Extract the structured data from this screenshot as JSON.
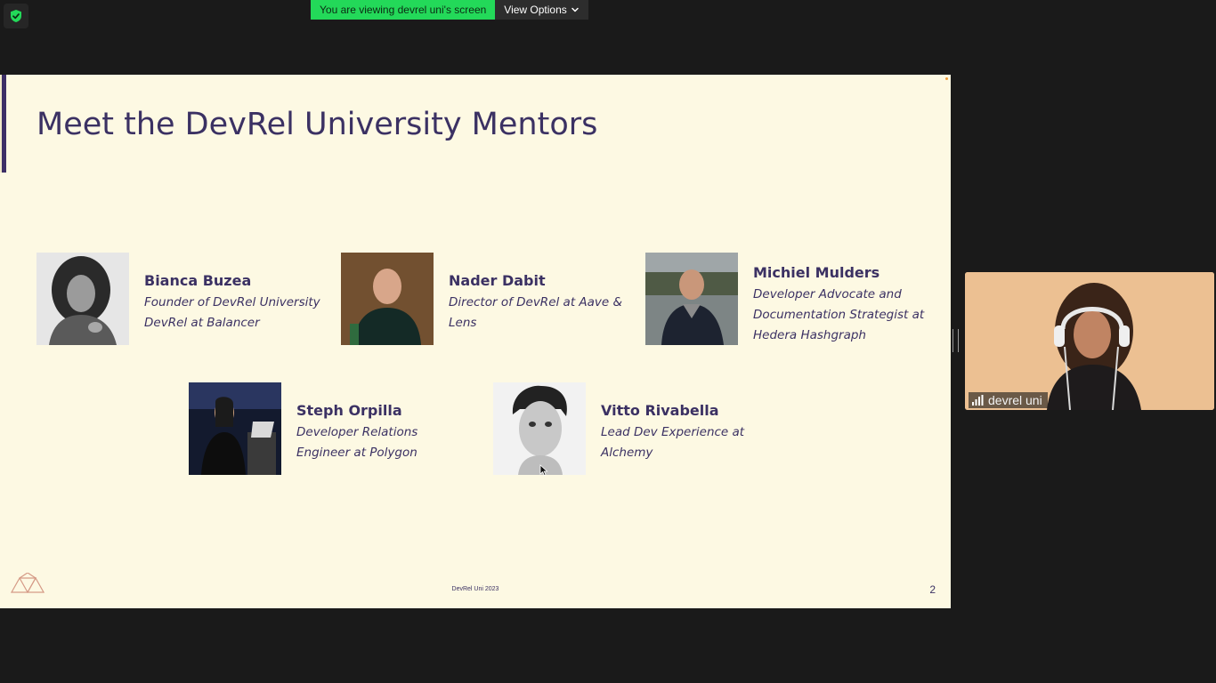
{
  "banner": {
    "message": "You are viewing devrel uni's screen",
    "options_label": "View Options"
  },
  "slide": {
    "title": "Meet the DevRel University Mentors",
    "footer": "DevRel Uni 2023",
    "page_number": "2",
    "mentors": [
      {
        "name": "Bianca Buzea",
        "role": "Founder of DevRel University\nDevRel at Balancer"
      },
      {
        "name": "Nader Dabit",
        "role": "Director of DevRel at Aave &\nLens"
      },
      {
        "name": "Michiel Mulders",
        "role": "Developer Advocate and\nDocumentation Strategist at\nHedera Hashgraph"
      },
      {
        "name": "Steph Orpilla",
        "role": " Developer Relations\nEngineer at Polygon"
      },
      {
        "name": "Vitto Rivabella",
        "role": "Lead Dev Experience at\nAlchemy"
      }
    ]
  },
  "participant": {
    "name": "devrel uni"
  },
  "colors": {
    "banner_green": "#23d959",
    "slide_bg": "#fdf9e3",
    "slide_text": "#3b3163",
    "app_bg": "#1a1a1a"
  }
}
